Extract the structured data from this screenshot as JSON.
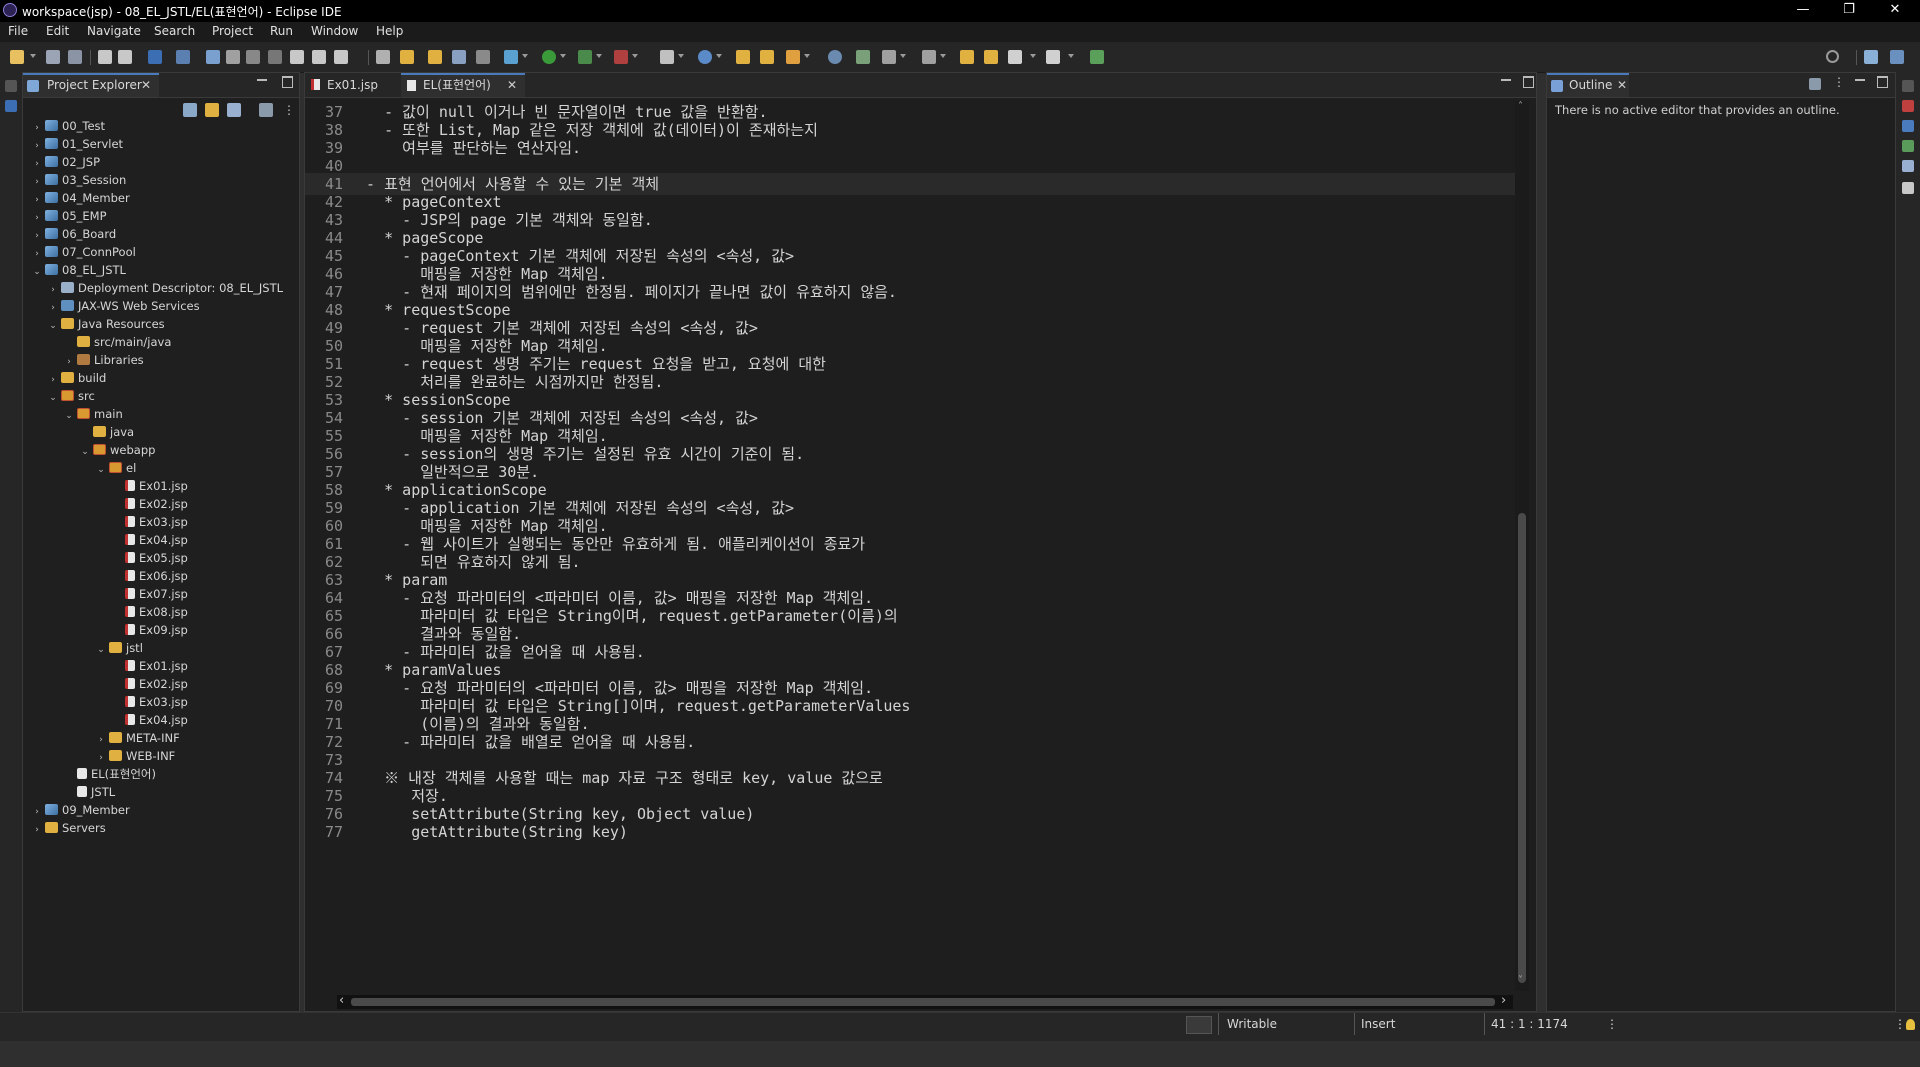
{
  "window": {
    "title": "workspace(jsp) - 08_EL_JSTL/EL(표현언어) - Eclipse IDE",
    "minimize": "—",
    "maximize": "❐",
    "close": "✕"
  },
  "menu": [
    "File",
    "Edit",
    "Navigate",
    "Search",
    "Project",
    "Run",
    "Window",
    "Help"
  ],
  "project_explorer": {
    "tab_label": "Project Explorer",
    "items": [
      {
        "label": "00_Test",
        "depth": 0,
        "chev": "›",
        "icon": "project"
      },
      {
        "label": "01_Servlet",
        "depth": 0,
        "chev": "›",
        "icon": "project"
      },
      {
        "label": "02_JSP",
        "depth": 0,
        "chev": "›",
        "icon": "project"
      },
      {
        "label": "03_Session",
        "depth": 0,
        "chev": "›",
        "icon": "project"
      },
      {
        "label": "04_Member",
        "depth": 0,
        "chev": "›",
        "icon": "project"
      },
      {
        "label": "05_EMP",
        "depth": 0,
        "chev": "›",
        "icon": "project"
      },
      {
        "label": "06_Board",
        "depth": 0,
        "chev": "›",
        "icon": "project"
      },
      {
        "label": "07_ConnPool",
        "depth": 0,
        "chev": "›",
        "icon": "project"
      },
      {
        "label": "08_EL_JSTL",
        "depth": 0,
        "chev": "⌄",
        "icon": "project"
      },
      {
        "label": "Deployment Descriptor: 08_EL_JSTL",
        "depth": 1,
        "chev": "›",
        "icon": "dd"
      },
      {
        "label": "JAX-WS Web Services",
        "depth": 1,
        "chev": "›",
        "icon": "jaxws"
      },
      {
        "label": "Java Resources",
        "depth": 1,
        "chev": "⌄",
        "icon": "folder"
      },
      {
        "label": "src/main/java",
        "depth": 2,
        "chev": "",
        "icon": "folder"
      },
      {
        "label": "Libraries",
        "depth": 2,
        "chev": "›",
        "icon": "lib"
      },
      {
        "label": "build",
        "depth": 1,
        "chev": "›",
        "icon": "folder"
      },
      {
        "label": "src",
        "depth": 1,
        "chev": "⌄",
        "icon": "srcfolder"
      },
      {
        "label": "main",
        "depth": 2,
        "chev": "⌄",
        "icon": "srcfolder"
      },
      {
        "label": "java",
        "depth": 3,
        "chev": "",
        "icon": "folder"
      },
      {
        "label": "webapp",
        "depth": 3,
        "chev": "⌄",
        "icon": "srcfolder"
      },
      {
        "label": "el",
        "depth": 4,
        "chev": "⌄",
        "icon": "srcfolder"
      },
      {
        "label": "Ex01.jsp",
        "depth": 5,
        "chev": "",
        "icon": "jsp"
      },
      {
        "label": "Ex02.jsp",
        "depth": 5,
        "chev": "",
        "icon": "jsp"
      },
      {
        "label": "Ex03.jsp",
        "depth": 5,
        "chev": "",
        "icon": "jsp"
      },
      {
        "label": "Ex04.jsp",
        "depth": 5,
        "chev": "",
        "icon": "jsp"
      },
      {
        "label": "Ex05.jsp",
        "depth": 5,
        "chev": "",
        "icon": "jsp"
      },
      {
        "label": "Ex06.jsp",
        "depth": 5,
        "chev": "",
        "icon": "jsp"
      },
      {
        "label": "Ex07.jsp",
        "depth": 5,
        "chev": "",
        "icon": "jsp"
      },
      {
        "label": "Ex08.jsp",
        "depth": 5,
        "chev": "",
        "icon": "jsp"
      },
      {
        "label": "Ex09.jsp",
        "depth": 5,
        "chev": "",
        "icon": "jsp"
      },
      {
        "label": "jstl",
        "depth": 4,
        "chev": "⌄",
        "icon": "folder"
      },
      {
        "label": "Ex01.jsp",
        "depth": 5,
        "chev": "",
        "icon": "jsp"
      },
      {
        "label": "Ex02.jsp",
        "depth": 5,
        "chev": "",
        "icon": "jsp"
      },
      {
        "label": "Ex03.jsp",
        "depth": 5,
        "chev": "",
        "icon": "jsp"
      },
      {
        "label": "Ex04.jsp",
        "depth": 5,
        "chev": "",
        "icon": "jsp"
      },
      {
        "label": "META-INF",
        "depth": 4,
        "chev": "›",
        "icon": "folder"
      },
      {
        "label": "WEB-INF",
        "depth": 4,
        "chev": "›",
        "icon": "folder"
      },
      {
        "label": "EL(표현언어)",
        "depth": 2,
        "chev": "",
        "icon": "file"
      },
      {
        "label": "JSTL",
        "depth": 2,
        "chev": "",
        "icon": "file"
      },
      {
        "label": "09_Member",
        "depth": 0,
        "chev": "›",
        "icon": "project"
      },
      {
        "label": "Servers",
        "depth": 0,
        "chev": "›",
        "icon": "folder"
      }
    ]
  },
  "editor": {
    "tabs": [
      {
        "label": "Ex01.jsp",
        "active": false
      },
      {
        "label": "EL(표현언어)",
        "active": true
      }
    ],
    "current_line": 41,
    "lines": [
      {
        "n": "37",
        "t": "    - 값이 null 이거나 빈 문자열이면 true 값을 반환함."
      },
      {
        "n": "38",
        "t": "    - 또한 List, Map 같은 저장 객체에 값(데이터)이 존재하는지"
      },
      {
        "n": "39",
        "t": "      여부를 판단하는 연산자임."
      },
      {
        "n": "40",
        "t": ""
      },
      {
        "n": "41",
        "t": "  - 표현 언어에서 사용할 수 있는 기본 객체"
      },
      {
        "n": "42",
        "t": "    * pageContext"
      },
      {
        "n": "43",
        "t": "      - JSP의 page 기본 객체와 동일함."
      },
      {
        "n": "44",
        "t": "    * pageScope"
      },
      {
        "n": "45",
        "t": "      - pageContext 기본 객체에 저장된 속성의 <속성, 값>"
      },
      {
        "n": "46",
        "t": "        매핑을 저장한 Map 객체임."
      },
      {
        "n": "47",
        "t": "      - 현재 페이지의 범위에만 한정됨. 페이지가 끝나면 값이 유효하지 않음."
      },
      {
        "n": "48",
        "t": "    * requestScope"
      },
      {
        "n": "49",
        "t": "      - request 기본 객체에 저장된 속성의 <속성, 값>"
      },
      {
        "n": "50",
        "t": "        매핑을 저장한 Map 객체임."
      },
      {
        "n": "51",
        "t": "      - request 생명 주기는 request 요청을 받고, 요청에 대한"
      },
      {
        "n": "52",
        "t": "        처리를 완료하는 시점까지만 한정됨."
      },
      {
        "n": "53",
        "t": "    * sessionScope"
      },
      {
        "n": "54",
        "t": "      - session 기본 객체에 저장된 속성의 <속성, 값>"
      },
      {
        "n": "55",
        "t": "        매핑을 저장한 Map 객체임."
      },
      {
        "n": "56",
        "t": "      - session의 생명 주기는 설정된 유효 시간이 기준이 됨."
      },
      {
        "n": "57",
        "t": "        일반적으로 30분."
      },
      {
        "n": "58",
        "t": "    * applicationScope"
      },
      {
        "n": "59",
        "t": "      - application 기본 객체에 저장된 속성의 <속성, 값>"
      },
      {
        "n": "60",
        "t": "        매핑을 저장한 Map 객체임."
      },
      {
        "n": "61",
        "t": "      - 웹 사이트가 실행되는 동안만 유효하게 됨. 애플리케이션이 종료가"
      },
      {
        "n": "62",
        "t": "        되면 유효하지 않게 됨."
      },
      {
        "n": "63",
        "t": "    * param"
      },
      {
        "n": "64",
        "t": "      - 요청 파라미터의 <파라미터 이름, 값> 매핑을 저장한 Map 객체임."
      },
      {
        "n": "65",
        "t": "        파라미터 값 타입은 String이며, request.getParameter(이름)의"
      },
      {
        "n": "66",
        "t": "        결과와 동일함."
      },
      {
        "n": "67",
        "t": "      - 파라미터 값을 얻어올 때 사용됨."
      },
      {
        "n": "68",
        "t": "    * paramValues"
      },
      {
        "n": "69",
        "t": "      - 요청 파라미터의 <파라미터 이름, 값> 매핑을 저장한 Map 객체임."
      },
      {
        "n": "70",
        "t": "        파라미터 값 타입은 String[]이며, request.getParameterValues"
      },
      {
        "n": "71",
        "t": "        (이름)의 결과와 동일함."
      },
      {
        "n": "72",
        "t": "      - 파라미터 값을 배열로 얻어올 때 사용됨."
      },
      {
        "n": "73",
        "t": ""
      },
      {
        "n": "74",
        "t": "    ※ 내장 객체를 사용할 때는 map 자료 구조 형태로 key, value 값으로"
      },
      {
        "n": "75",
        "t": "       저장."
      },
      {
        "n": "76",
        "t": "       setAttribute(String key, Object value)"
      },
      {
        "n": "77",
        "t": "       getAttribute(String key)"
      }
    ]
  },
  "outline": {
    "tab_label": "Outline",
    "message": "There is no active editor that provides an outline."
  },
  "status": {
    "writable": "Writable",
    "insert": "Insert",
    "position": "41 : 1 : 1174"
  },
  "icons": {
    "close": "✕",
    "chevron_left": "‹",
    "chevron_right": "›",
    "arrow_up": "˄",
    "arrow_down": "˅",
    "kebab": "⋮"
  }
}
